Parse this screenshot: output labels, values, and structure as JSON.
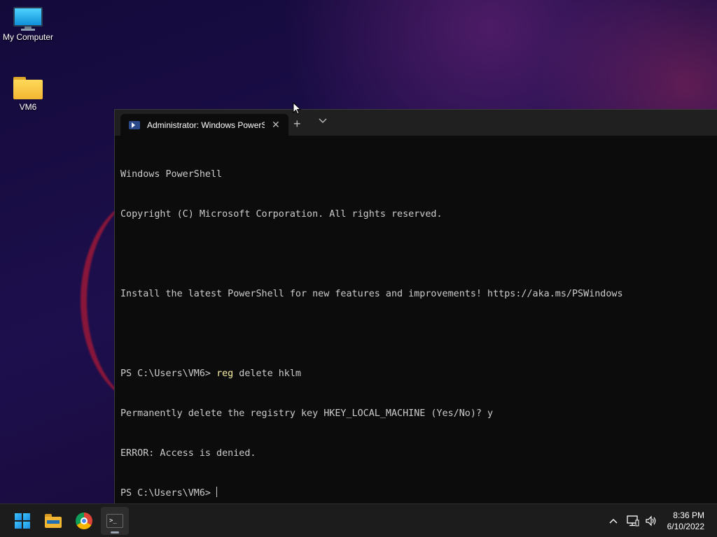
{
  "desktop": {
    "icons": [
      {
        "label": "My Computer",
        "icon": "computer-icon"
      },
      {
        "label": "VM6",
        "icon": "folder-icon"
      }
    ]
  },
  "terminal": {
    "tab_title": "Administrator: Windows PowerS",
    "close_glyph": "✕",
    "new_tab_glyph": "+",
    "lines": [
      "Windows PowerShell",
      "Copyright (C) Microsoft Corporation. All rights reserved.",
      "",
      "Install the latest PowerShell for new features and improvements! https://aka.ms/PSWindows",
      "",
      "PS C:\\Users\\VM6> ",
      "Permanently delete the registry key HKEY_LOCAL_MACHINE (Yes/No)? y",
      "ERROR: Access is denied.",
      "PS C:\\Users\\VM6> "
    ],
    "command_keyword": "reg",
    "command_args": " delete hklm"
  },
  "taskbar": {
    "apps": [
      "start-icon",
      "file-explorer-icon",
      "chrome-icon",
      "terminal-icon"
    ],
    "tray": {
      "time": "8:36 PM",
      "date": "6/10/2022"
    }
  },
  "colors": {
    "console_bg": "#0c0c0c",
    "console_text": "#cccccc",
    "keyword": "#f9f1a5",
    "taskbar_bg": "#1c1c1c"
  }
}
